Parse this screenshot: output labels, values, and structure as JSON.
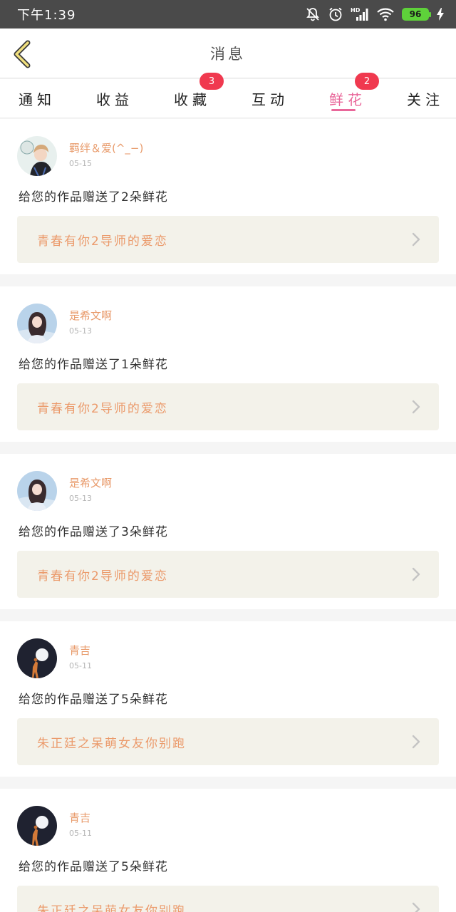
{
  "status_bar": {
    "time": "下午1:39",
    "battery": "96",
    "icons": [
      "mute-bell-icon",
      "alarm-icon",
      "hd-signal-icon",
      "wifi-icon",
      "battery-icon",
      "charging-icon"
    ]
  },
  "header": {
    "title": "消息",
    "back_icon": "chevron-left-icon"
  },
  "tabs": [
    {
      "label": "通知",
      "badge": null
    },
    {
      "label": "收益",
      "badge": null
    },
    {
      "label": "收藏",
      "badge": "3"
    },
    {
      "label": "互动",
      "badge": null
    },
    {
      "label": "鲜花",
      "badge": "2",
      "active": true
    },
    {
      "label": "关注",
      "badge": null
    }
  ],
  "colors": {
    "accent": "#e9679a",
    "badge": "#f0394f",
    "username": "#e89a6a",
    "work_title": "#eb9a6b",
    "work_bg": "#f3f2ea"
  },
  "messages": [
    {
      "username": "羁绊＆爱(^_−)",
      "date": "05-15",
      "text": "给您的作品赠送了2朵鲜花",
      "work_title": "青春有你2导师的爱恋",
      "avatar": "avatar-boy"
    },
    {
      "username": "是希文啊",
      "date": "05-13",
      "text": "给您的作品赠送了1朵鲜花",
      "work_title": "青春有你2导师的爱恋",
      "avatar": "avatar-girl"
    },
    {
      "username": "是希文啊",
      "date": "05-13",
      "text": "给您的作品赠送了3朵鲜花",
      "work_title": "青春有你2导师的爱恋",
      "avatar": "avatar-girl"
    },
    {
      "username": "青吉",
      "date": "05-11",
      "text": "给您的作品赠送了5朵鲜花",
      "work_title": "朱正廷之呆萌女友你别跑",
      "avatar": "avatar-moon"
    },
    {
      "username": "青吉",
      "date": "05-11",
      "text": "给您的作品赠送了5朵鲜花",
      "work_title": "朱正廷之呆萌女友你别跑",
      "avatar": "avatar-moon"
    }
  ]
}
